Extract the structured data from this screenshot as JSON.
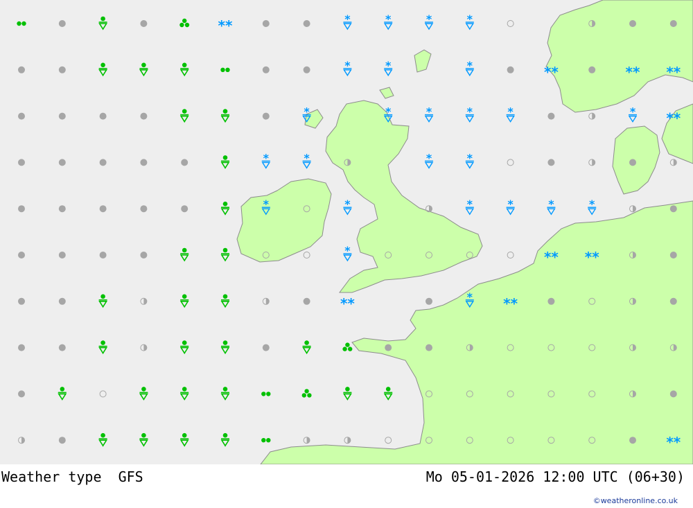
{
  "footer": {
    "title": "Weather type  GFS",
    "datetime": "Mo 05-01-2026 12:00 UTC (06+30)"
  },
  "credit": "©weatheronline.co.uk",
  "colors": {
    "sea": "#eeeeee",
    "land": "#ccffaa",
    "coast": "#8c8c8c",
    "dot": "#a6a6a6",
    "rain": "#00c000",
    "snow": "#0099ff"
  },
  "grid": {
    "columns": 17,
    "legend_codes": {
      "G": "overcast-dot",
      "O": "clear-circle",
      "H": "half-cloudy",
      "S": "rain-shower",
      "D": "drizzle",
      "R": "rain-heavy",
      "N": "snow-shower",
      "W": "snow",
      "0": "none"
    },
    "rows": [
      [
        "D",
        "G",
        "S",
        "G",
        "R",
        "W",
        "G",
        "G",
        "N",
        "N",
        "N",
        "N",
        "O",
        "0",
        "H",
        "G",
        "G"
      ],
      [
        "G",
        "G",
        "S",
        "S",
        "S",
        "D",
        "G",
        "G",
        "N",
        "N",
        "0",
        "N",
        "G",
        "W",
        "G",
        "W",
        "W"
      ],
      [
        "G",
        "G",
        "G",
        "G",
        "S",
        "S",
        "G",
        "N",
        "0",
        "N",
        "N",
        "N",
        "N",
        "G",
        "H",
        "N",
        "W"
      ],
      [
        "G",
        "G",
        "G",
        "G",
        "G",
        "S",
        "N",
        "N",
        "H",
        "0",
        "N",
        "N",
        "O",
        "G",
        "H",
        "G",
        "H"
      ],
      [
        "G",
        "G",
        "G",
        "G",
        "G",
        "S",
        "N",
        "O",
        "N",
        "0",
        "H",
        "N",
        "N",
        "N",
        "N",
        "H",
        "G"
      ],
      [
        "G",
        "G",
        "G",
        "G",
        "S",
        "S",
        "O",
        "O",
        "N",
        "O",
        "O",
        "O",
        "O",
        "W",
        "W",
        "H",
        "G"
      ],
      [
        "G",
        "G",
        "S",
        "H",
        "S",
        "S",
        "H",
        "G",
        "W",
        "0",
        "G",
        "N",
        "W",
        "G",
        "O",
        "H",
        "G"
      ],
      [
        "G",
        "G",
        "S",
        "H",
        "S",
        "S",
        "G",
        "S",
        "R",
        "G",
        "G",
        "H",
        "O",
        "O",
        "O",
        "H",
        "H"
      ],
      [
        "G",
        "S",
        "O",
        "S",
        "S",
        "S",
        "D",
        "R",
        "S",
        "S",
        "O",
        "O",
        "O",
        "O",
        "O",
        "H",
        "G"
      ],
      [
        "H",
        "G",
        "S",
        "S",
        "S",
        "S",
        "D",
        "H",
        "H",
        "O",
        "O",
        "O",
        "O",
        "O",
        "O",
        "G",
        "W"
      ]
    ]
  }
}
